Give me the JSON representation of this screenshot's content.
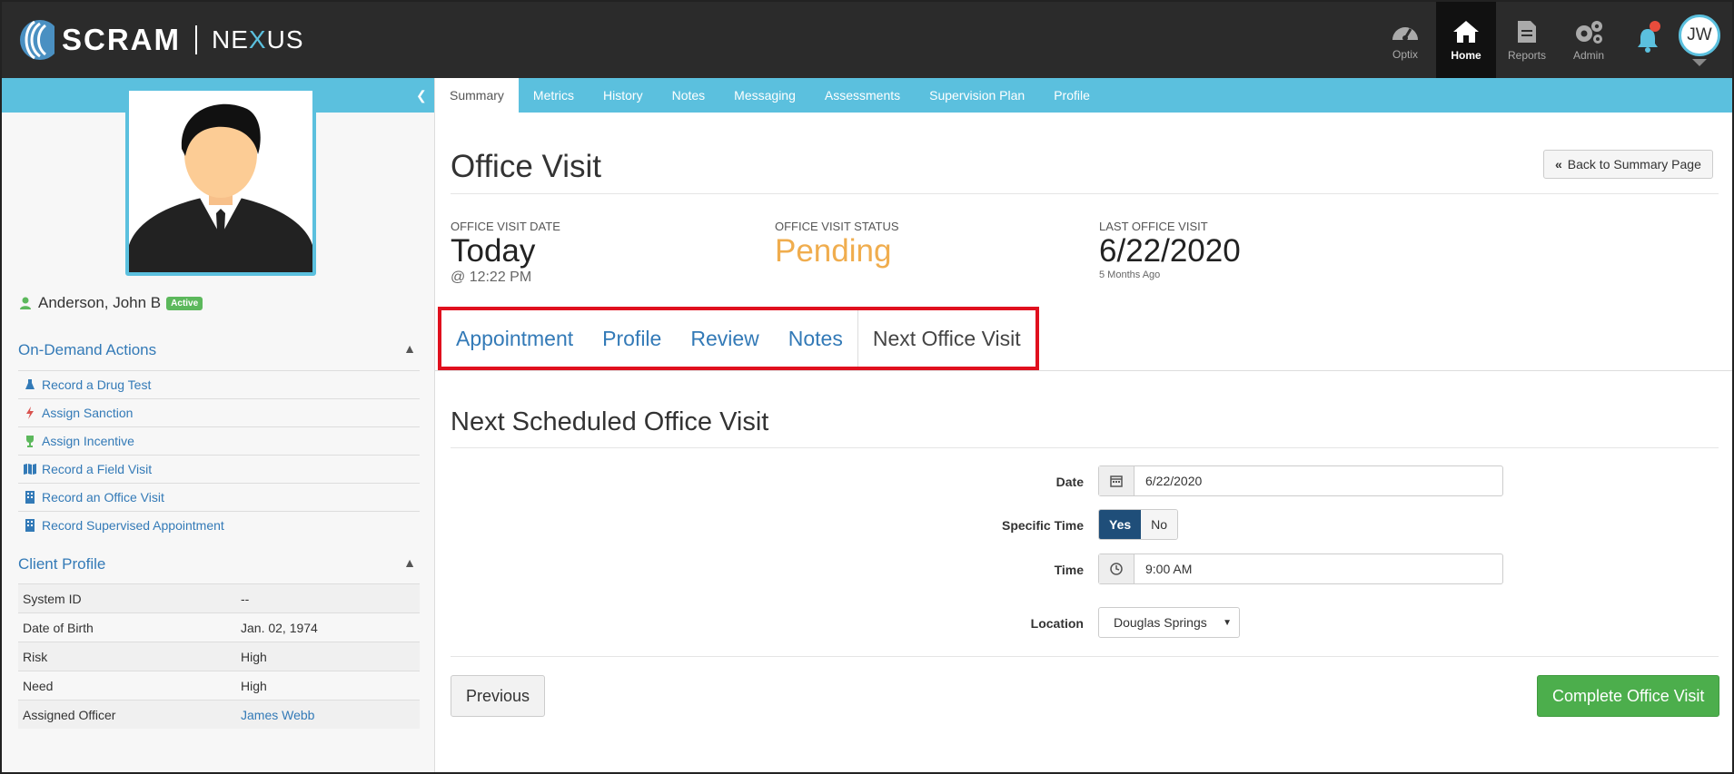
{
  "header": {
    "brand": "SCRAM",
    "product_pre": "NE",
    "product_x": "X",
    "product_post": "US",
    "nav": [
      {
        "label": "Optix",
        "icon": "speedometer-icon"
      },
      {
        "label": "Home",
        "icon": "home-icon"
      },
      {
        "label": "Reports",
        "icon": "document-icon"
      },
      {
        "label": "Admin",
        "icon": "gears-icon"
      }
    ],
    "user_initials": "JW"
  },
  "sidebar": {
    "client_name": "Anderson, John B",
    "status_badge": "Active",
    "on_demand_title": "On-Demand Actions",
    "actions": [
      {
        "label": "Record a Drug Test",
        "icon": "flask-icon"
      },
      {
        "label": "Assign Sanction",
        "icon": "lightning-icon"
      },
      {
        "label": "Assign Incentive",
        "icon": "trophy-icon"
      },
      {
        "label": "Record a Field Visit",
        "icon": "map-icon"
      },
      {
        "label": "Record an Office Visit",
        "icon": "building-icon"
      },
      {
        "label": "Record Supervised Appointment",
        "icon": "building-icon"
      }
    ],
    "profile_title": "Client Profile",
    "profile": [
      {
        "key": "System ID",
        "value": "--"
      },
      {
        "key": "Date of Birth",
        "value": "Jan. 02, 1974"
      },
      {
        "key": "Risk",
        "value": "High"
      },
      {
        "key": "Need",
        "value": "High"
      },
      {
        "key": "Assigned Officer",
        "value": "James Webb"
      }
    ]
  },
  "subnav": [
    "Summary",
    "Metrics",
    "History",
    "Notes",
    "Messaging",
    "Assessments",
    "Supervision Plan",
    "Profile"
  ],
  "main": {
    "title": "Office Visit",
    "back_label": "Back to Summary Page",
    "visit_date_label": "Office Visit Date",
    "visit_date": "Today",
    "visit_time": "@ 12:22 PM",
    "status_label": "Office Visit Status",
    "status": "Pending",
    "status_color": "#f0ad4e",
    "last_visit_label": "Last Office Visit",
    "last_visit": "6/22/2020",
    "last_visit_ago": "5 Months Ago",
    "steps": [
      "Appointment",
      "Profile",
      "Review",
      "Notes",
      "Next Office Visit"
    ],
    "section_title": "Next Scheduled Office Visit",
    "form": {
      "date_label": "Date",
      "date_value": "6/22/2020",
      "specific_time_label": "Specific Time",
      "yes": "Yes",
      "no": "No",
      "time_label": "Time",
      "time_value": "9:00 AM",
      "location_label": "Location",
      "location_value": "Douglas Springs"
    },
    "previous_label": "Previous",
    "complete_label": "Complete Office Visit"
  }
}
